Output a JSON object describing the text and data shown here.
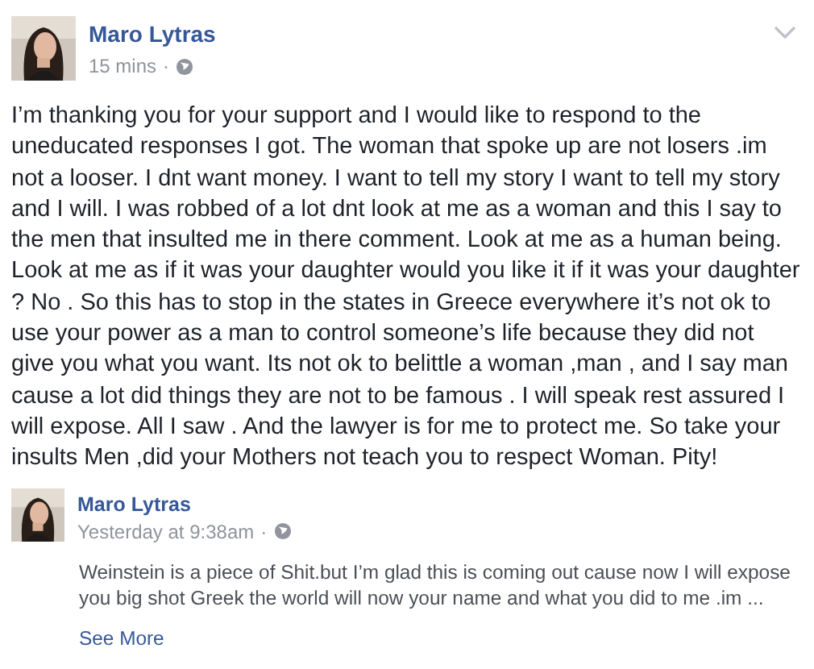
{
  "post": {
    "author": "Maro Lytras",
    "time": "15 mins",
    "separator": "·",
    "text": "I’m thanking you for your support and I would like to respond to the uneducated responses I got. The woman that spoke up are not losers .im not a looser. I dnt want money. I want to tell my story I want to tell my story and I will. I was robbed of a lot dnt look at me as a woman and this I say to the men that insulted me in there comment. Look at me as a human being. Look at me as if it was your daughter would you like it if it was your daughter ? No . So this has to stop in the states in Greece everywhere it’s not ok to use your power as a man to control someone’s life because they did not give you what you want. Its not ok to belittle a woman ,man , and I say man cause a lot did things they are not to be famous . I will speak rest assured I will expose. All I saw . And the lawyer is for me to protect me. So take your insults Men ,did your Mothers not teach you to respect Woman. Pity!"
  },
  "shared_post": {
    "author": "Maro Lytras",
    "time": "Yesterday at 9:38am",
    "separator": "·",
    "text": "Weinstein is a piece of Shit.but I’m glad this is coming out cause now I will expose you big shot Greek the world will now your name and what you did to me .im ...",
    "see_more": "See More"
  }
}
